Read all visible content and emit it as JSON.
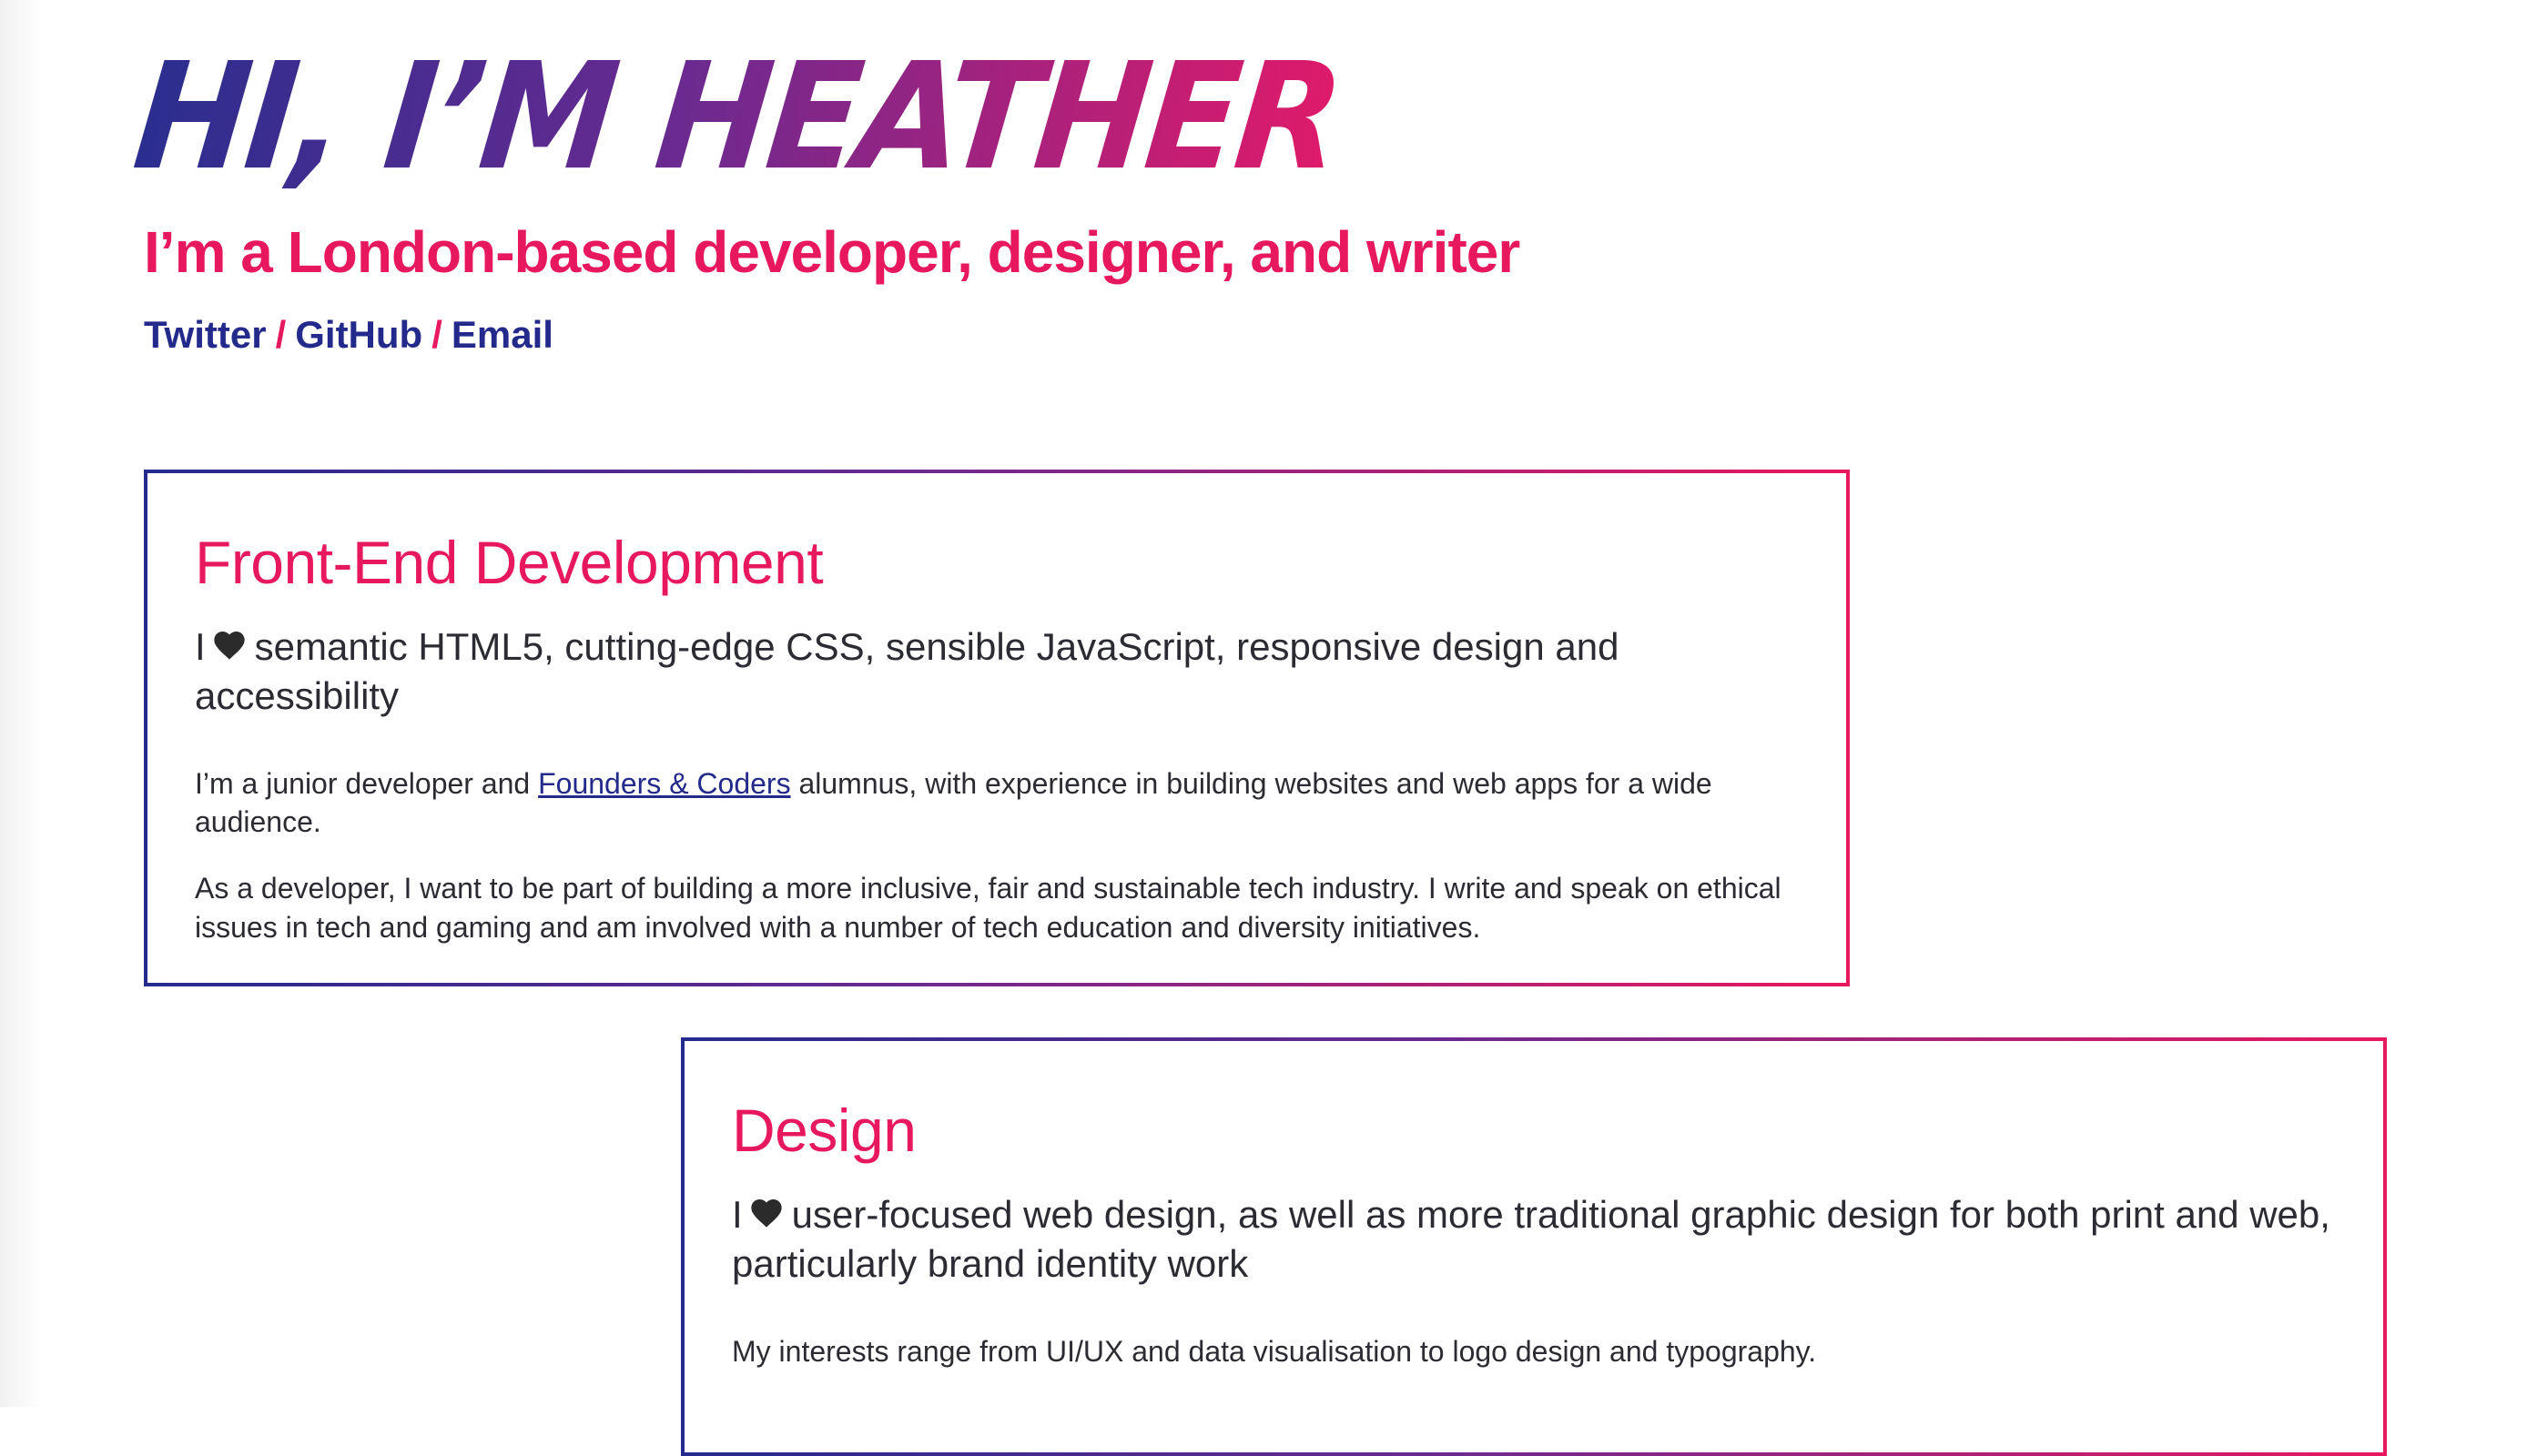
{
  "hero": {
    "title": "Hi, I’m Heather",
    "tagline": "I’m a London-based developer, designer, and writer"
  },
  "social": {
    "links": [
      {
        "label": "Twitter"
      },
      {
        "label": "GitHub"
      },
      {
        "label": "Email"
      }
    ],
    "separator": "/"
  },
  "sections": [
    {
      "heading": "Front-End Development",
      "lead_prefix": "I",
      "lead_icon": "heart-icon",
      "lead_text": "semantic HTML5, cutting-edge CSS, sensible JavaScript, responsive design and accessibility",
      "para1_before": "I’m a junior developer and ",
      "para1_link": "Founders & Coders",
      "para1_after": " alumnus, with experience in building websites and web apps for a wide audience.",
      "para2": "As a developer, I want to be part of building a more inclusive, fair and sustainable tech industry. I write and speak on ethical issues in tech and gaming and am involved with a number of tech education and diversity initiatives."
    },
    {
      "heading": "Design",
      "lead_prefix": "I",
      "lead_icon": "heart-icon",
      "lead_text": "user-focused web design, as well as more traditional graphic design for both print and web, particularly brand identity work",
      "para1": "My interests range from UI/UX and data visualisation to logo design and typography."
    }
  ],
  "colors": {
    "accent_pink": "#e8185f",
    "accent_navy": "#232a8c",
    "accent_purple": "#6a2a90",
    "text": "#2b2b33"
  }
}
